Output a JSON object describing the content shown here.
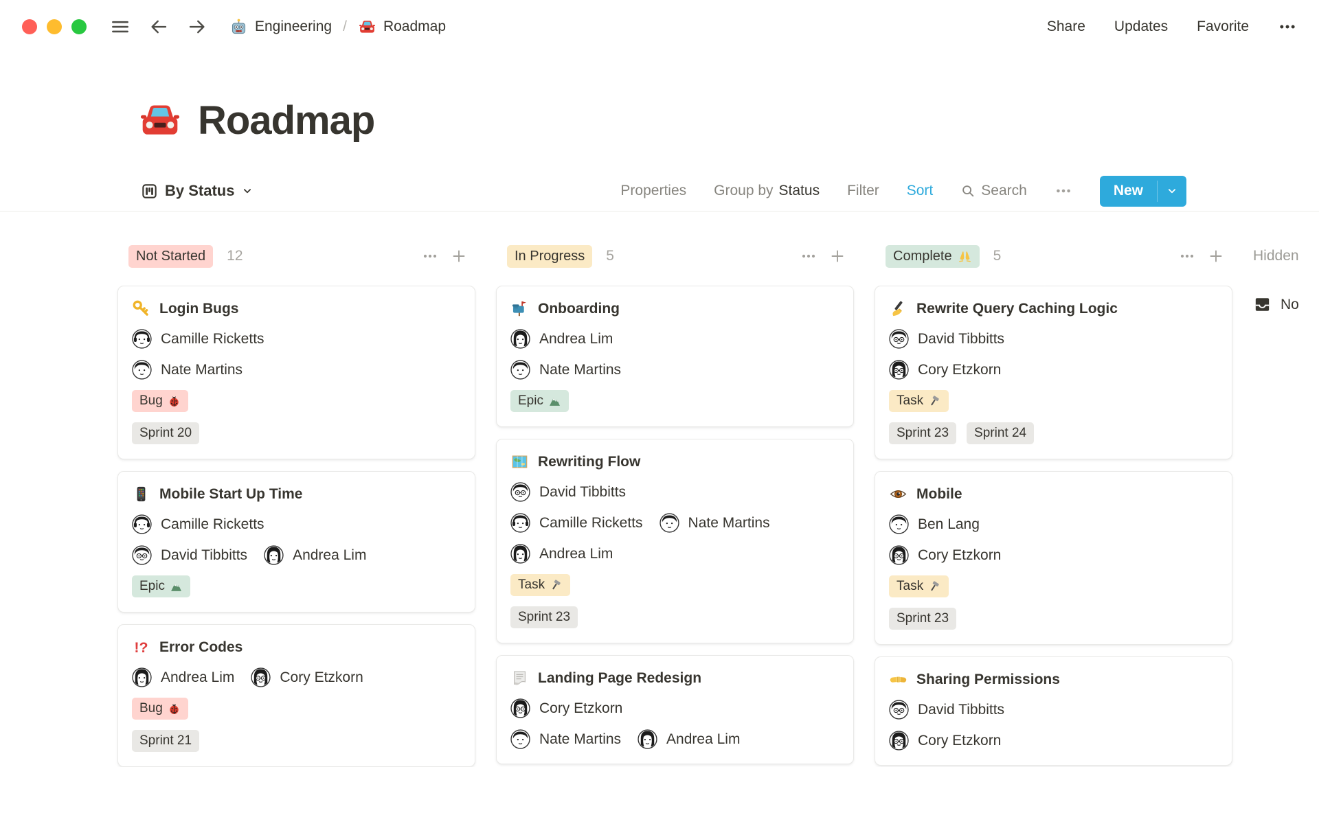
{
  "window": {
    "controls": [
      "close",
      "minimize",
      "zoom"
    ],
    "breadcrumb": [
      {
        "icon": "robot-icon",
        "label": "Engineering"
      },
      {
        "icon": "car-icon",
        "label": "Roadmap"
      }
    ],
    "breadcrumb_separator": "/",
    "actions": {
      "share": "Share",
      "updates": "Updates",
      "favorite": "Favorite"
    }
  },
  "page": {
    "icon": "car-icon",
    "title": "Roadmap"
  },
  "toolbar": {
    "view": {
      "icon": "board-view-icon",
      "label": "By Status"
    },
    "properties": "Properties",
    "group_by_prefix": "Group by",
    "group_by_value": "Status",
    "filter": "Filter",
    "sort": "Sort",
    "search": "Search",
    "new_label": "New"
  },
  "colors": {
    "accent_blue": "#2EAADC",
    "badge_pink": "#FFD4CF",
    "badge_yellow": "#FBEAC5",
    "badge_green": "#D5E8DD",
    "tag_gray": "#E9E8E5",
    "traffic_red": "#FF5F57",
    "traffic_yellow": "#FEBC2E",
    "traffic_green": "#28C840",
    "text_primary": "#37352F"
  },
  "board": {
    "columns": [
      {
        "label": "Not Started",
        "color": "pink",
        "count": "12",
        "cards": [
          {
            "icon": "key-icon",
            "title": "Login Bugs",
            "people_rows": [
              [
                {
                  "name": "Camille Ricketts",
                  "avatar": "headphones"
                }
              ],
              [
                {
                  "name": "Nate Martins",
                  "avatar": "short"
                }
              ]
            ],
            "tag_rows": [
              [
                {
                  "label": "Bug",
                  "icon": "ladybug-icon",
                  "color": "pink"
                }
              ],
              [
                {
                  "label": "Sprint 20",
                  "color": "gray"
                }
              ]
            ]
          },
          {
            "icon": "phone-icon",
            "title": "Mobile Start Up Time",
            "people_rows": [
              [
                {
                  "name": "Camille Ricketts",
                  "avatar": "headphones"
                }
              ],
              [
                {
                  "name": "David Tibbitts",
                  "avatar": "short-glasses"
                },
                {
                  "name": "Andrea Lim",
                  "avatar": "bob"
                }
              ]
            ],
            "tag_rows": [
              [
                {
                  "label": "Epic",
                  "icon": "mountain-icon",
                  "color": "green"
                }
              ]
            ]
          },
          {
            "icon": "interrobang-icon",
            "title": "Error Codes",
            "people_rows": [
              [
                {
                  "name": "Andrea Lim",
                  "avatar": "bob"
                },
                {
                  "name": "Cory Etzkorn",
                  "avatar": "long-glasses"
                }
              ]
            ],
            "tag_rows": [
              [
                {
                  "label": "Bug",
                  "icon": "ladybug-icon",
                  "color": "pink"
                }
              ],
              [
                {
                  "label": "Sprint 21",
                  "color": "gray"
                }
              ]
            ]
          }
        ]
      },
      {
        "label": "In Progress",
        "color": "yellow",
        "count": "5",
        "cards": [
          {
            "icon": "mailbox-icon",
            "title": "Onboarding",
            "people_rows": [
              [
                {
                  "name": "Andrea Lim",
                  "avatar": "bob"
                }
              ],
              [
                {
                  "name": "Nate Martins",
                  "avatar": "short"
                }
              ]
            ],
            "tag_rows": [
              [
                {
                  "label": "Epic",
                  "icon": "mountain-icon",
                  "color": "green"
                }
              ]
            ]
          },
          {
            "icon": "map-icon",
            "title": "Rewriting Flow",
            "people_rows": [
              [
                {
                  "name": "David Tibbitts",
                  "avatar": "short-glasses"
                }
              ],
              [
                {
                  "name": "Camille Ricketts",
                  "avatar": "headphones"
                },
                {
                  "name": "Nate Martins",
                  "avatar": "short"
                }
              ],
              [
                {
                  "name": "Andrea Lim",
                  "avatar": "bob"
                }
              ]
            ],
            "tag_rows": [
              [
                {
                  "label": "Task",
                  "icon": "hammer-icon",
                  "color": "tan"
                }
              ],
              [
                {
                  "label": "Sprint 23",
                  "color": "gray"
                }
              ]
            ]
          },
          {
            "icon": "page-icon",
            "title": "Landing Page Redesign",
            "people_rows": [
              [
                {
                  "name": "Cory Etzkorn",
                  "avatar": "long-glasses"
                }
              ],
              [
                {
                  "name": "Nate Martins",
                  "avatar": "short"
                },
                {
                  "name": "Andrea Lim",
                  "avatar": "bob"
                }
              ]
            ],
            "tag_rows": []
          }
        ]
      },
      {
        "label": "Complete",
        "badge_icon": "raised-hands-icon",
        "color": "green",
        "count": "5",
        "cards": [
          {
            "icon": "writing-hand-icon",
            "title": "Rewrite Query Caching Logic",
            "people_rows": [
              [
                {
                  "name": "David Tibbitts",
                  "avatar": "short-glasses"
                }
              ],
              [
                {
                  "name": "Cory Etzkorn",
                  "avatar": "long-glasses"
                }
              ]
            ],
            "tag_rows": [
              [
                {
                  "label": "Task",
                  "icon": "hammer-icon",
                  "color": "tan"
                }
              ],
              [
                {
                  "label": "Sprint 23",
                  "color": "gray"
                },
                {
                  "label": "Sprint 24",
                  "color": "gray"
                }
              ]
            ]
          },
          {
            "icon": "eye-icon",
            "title": "Mobile",
            "people_rows": [
              [
                {
                  "name": "Ben Lang",
                  "avatar": "short"
                }
              ],
              [
                {
                  "name": "Cory Etzkorn",
                  "avatar": "long-glasses"
                }
              ]
            ],
            "tag_rows": [
              [
                {
                  "label": "Task",
                  "icon": "hammer-icon",
                  "color": "tan"
                }
              ],
              [
                {
                  "label": "Sprint 23",
                  "color": "gray"
                }
              ]
            ]
          },
          {
            "icon": "handshake-icon",
            "title": "Sharing Permissions",
            "people_rows": [
              [
                {
                  "name": "David Tibbitts",
                  "avatar": "short-glasses"
                }
              ],
              [
                {
                  "name": "Cory Etzkorn",
                  "avatar": "long-glasses"
                }
              ]
            ],
            "tag_rows": []
          }
        ]
      }
    ],
    "hidden": {
      "label": "Hidden",
      "group_icon": "inbox-icon",
      "group_label": "No"
    }
  }
}
